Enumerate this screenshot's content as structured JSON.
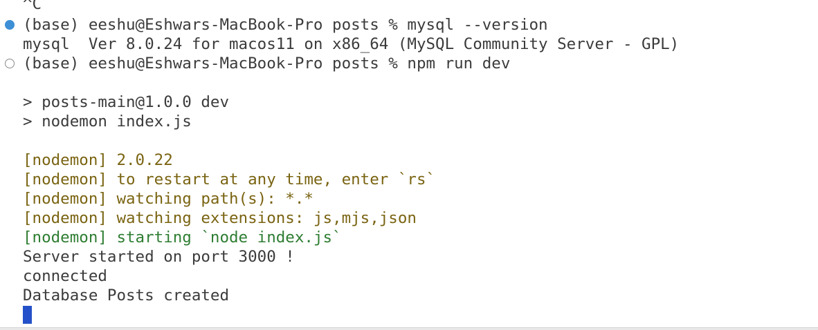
{
  "terminal": {
    "lines": [
      {
        "text": "^C"
      },
      {
        "text": "(base) eeshu@Eshwars-MacBook-Pro posts % mysql --version",
        "marker": "filled"
      },
      {
        "text": "mysql  Ver 8.0.24 for macos11 on x86_64 (MySQL Community Server - GPL)"
      },
      {
        "text": "(base) eeshu@Eshwars-MacBook-Pro posts % npm run dev",
        "marker": "hollow"
      },
      {
        "text": ""
      },
      {
        "text": "> posts-main@1.0.0 dev"
      },
      {
        "text": "> nodemon index.js"
      },
      {
        "text": ""
      },
      {
        "text": "[nodemon] 2.0.22",
        "color": "yellow"
      },
      {
        "text": "[nodemon] to restart at any time, enter `rs`",
        "color": "yellow"
      },
      {
        "text": "[nodemon] watching path(s): *.*",
        "color": "yellow"
      },
      {
        "text": "[nodemon] watching extensions: js,mjs,json",
        "color": "yellow"
      },
      {
        "text": "[nodemon] starting `node index.js`",
        "color": "green"
      },
      {
        "text": "Server started on port 3000 !"
      },
      {
        "text": "connected"
      },
      {
        "text": "Database Posts created"
      }
    ],
    "colors": {
      "default_text": "#3b3b3b",
      "nodemon_yellow": "#7a6412",
      "nodemon_green": "#2e7d32",
      "success_marker": "#3d8fd6",
      "cursor": "#2451c9"
    }
  }
}
